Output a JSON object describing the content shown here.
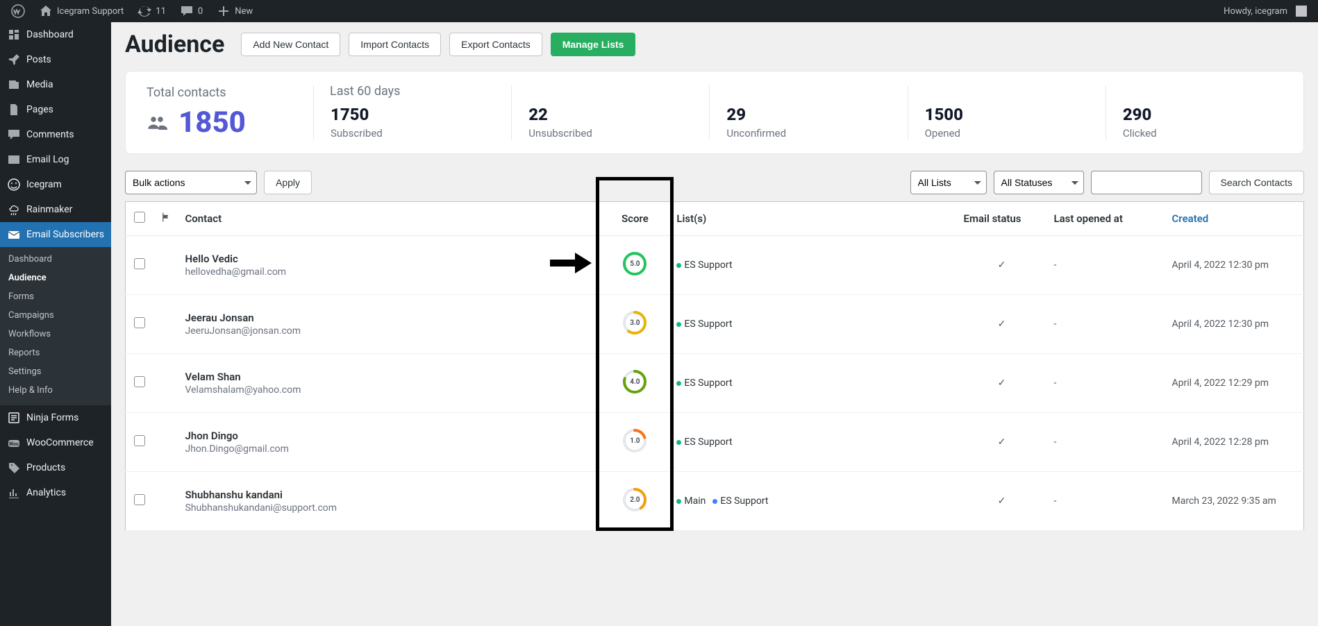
{
  "topbar": {
    "site_name": "Icegram Support",
    "updates": "11",
    "comments": "0",
    "new": "New",
    "howdy": "Howdy, icegram"
  },
  "sidebar": {
    "items": [
      {
        "label": "Dashboard",
        "icon": "dashboard"
      },
      {
        "label": "Posts",
        "icon": "pin"
      },
      {
        "label": "Media",
        "icon": "media"
      },
      {
        "label": "Pages",
        "icon": "page"
      },
      {
        "label": "Comments",
        "icon": "comment"
      },
      {
        "label": "Email Log",
        "icon": "envelope"
      },
      {
        "label": "Icegram",
        "icon": "face"
      },
      {
        "label": "Rainmaker",
        "icon": "rain"
      },
      {
        "label": "Email Subscribers",
        "icon": "mailclosed",
        "active": true
      },
      {
        "label": "Ninja Forms",
        "icon": "form"
      },
      {
        "label": "WooCommerce",
        "icon": "woo"
      },
      {
        "label": "Products",
        "icon": "tag"
      },
      {
        "label": "Analytics",
        "icon": "chart"
      }
    ],
    "sub": [
      "Dashboard",
      "Audience",
      "Forms",
      "Campaigns",
      "Workflows",
      "Reports",
      "Settings",
      "Help & Info"
    ],
    "sub_current": "Audience"
  },
  "page": {
    "title": "Audience",
    "buttons": {
      "add": "Add New Contact",
      "import": "Import Contacts",
      "export": "Export Contacts",
      "manage": "Manage Lists"
    }
  },
  "stats": {
    "total_label": "Total contacts",
    "total_value": "1850",
    "last60_label": "Last 60 days",
    "cols": [
      {
        "num": "1750",
        "lbl": "Subscribed"
      },
      {
        "num": "22",
        "lbl": "Unsubscribed"
      },
      {
        "num": "29",
        "lbl": "Unconfirmed"
      },
      {
        "num": "1500",
        "lbl": "Opened"
      },
      {
        "num": "290",
        "lbl": "Clicked"
      }
    ]
  },
  "toolbar": {
    "bulk": "Bulk actions",
    "apply": "Apply",
    "all_lists": "All Lists",
    "all_statuses": "All Statuses",
    "search_btn": "Search Contacts"
  },
  "columns": {
    "contact": "Contact",
    "score": "Score",
    "lists": "List(s)",
    "email_status": "Email status",
    "last_opened": "Last opened at",
    "created": "Created"
  },
  "colors": {
    "score5": "#22c55e",
    "score4": "#65a30d",
    "score3": "#eab308",
    "score2": "#f59e0b",
    "score1": "#f97316"
  },
  "rows": [
    {
      "name": "Hello Vedic",
      "email": "hellovedha@gmail.com",
      "score": "5.0",
      "score_frac": 1.0,
      "score_color": "#22c55e",
      "lists": [
        {
          "dot": "green",
          "name": "ES Support"
        }
      ],
      "email_ok": true,
      "last_opened": "-",
      "created": "April 4, 2022 12:30 pm"
    },
    {
      "name": "Jeerau Jonsan",
      "email": "JeeruJonsan@jonsan.com",
      "score": "3.0",
      "score_frac": 0.6,
      "score_color": "#eab308",
      "lists": [
        {
          "dot": "green",
          "name": "ES Support"
        }
      ],
      "email_ok": true,
      "last_opened": "-",
      "created": "April 4, 2022 12:30 pm"
    },
    {
      "name": "Velam Shan",
      "email": "Velamshalam@yahoo.com",
      "score": "4.0",
      "score_frac": 0.8,
      "score_color": "#65a30d",
      "lists": [
        {
          "dot": "green",
          "name": "ES Support"
        }
      ],
      "email_ok": true,
      "last_opened": "-",
      "created": "April 4, 2022 12:29 pm"
    },
    {
      "name": "Jhon Dingo",
      "email": "Jhon.Dingo@gmail.com",
      "score": "1.0",
      "score_frac": 0.2,
      "score_color": "#f97316",
      "lists": [
        {
          "dot": "green",
          "name": "ES Support"
        }
      ],
      "email_ok": true,
      "last_opened": "-",
      "created": "April 4, 2022 12:28 pm"
    },
    {
      "name": "Shubhanshu kandani",
      "email": "Shubhanshukandani@support.com",
      "score": "2.0",
      "score_frac": 0.4,
      "score_color": "#f59e0b",
      "lists": [
        {
          "dot": "green",
          "name": "Main"
        },
        {
          "dot": "blue",
          "name": "ES Support"
        }
      ],
      "email_ok": true,
      "last_opened": "-",
      "created": "March 23, 2022 9:35 am"
    }
  ]
}
